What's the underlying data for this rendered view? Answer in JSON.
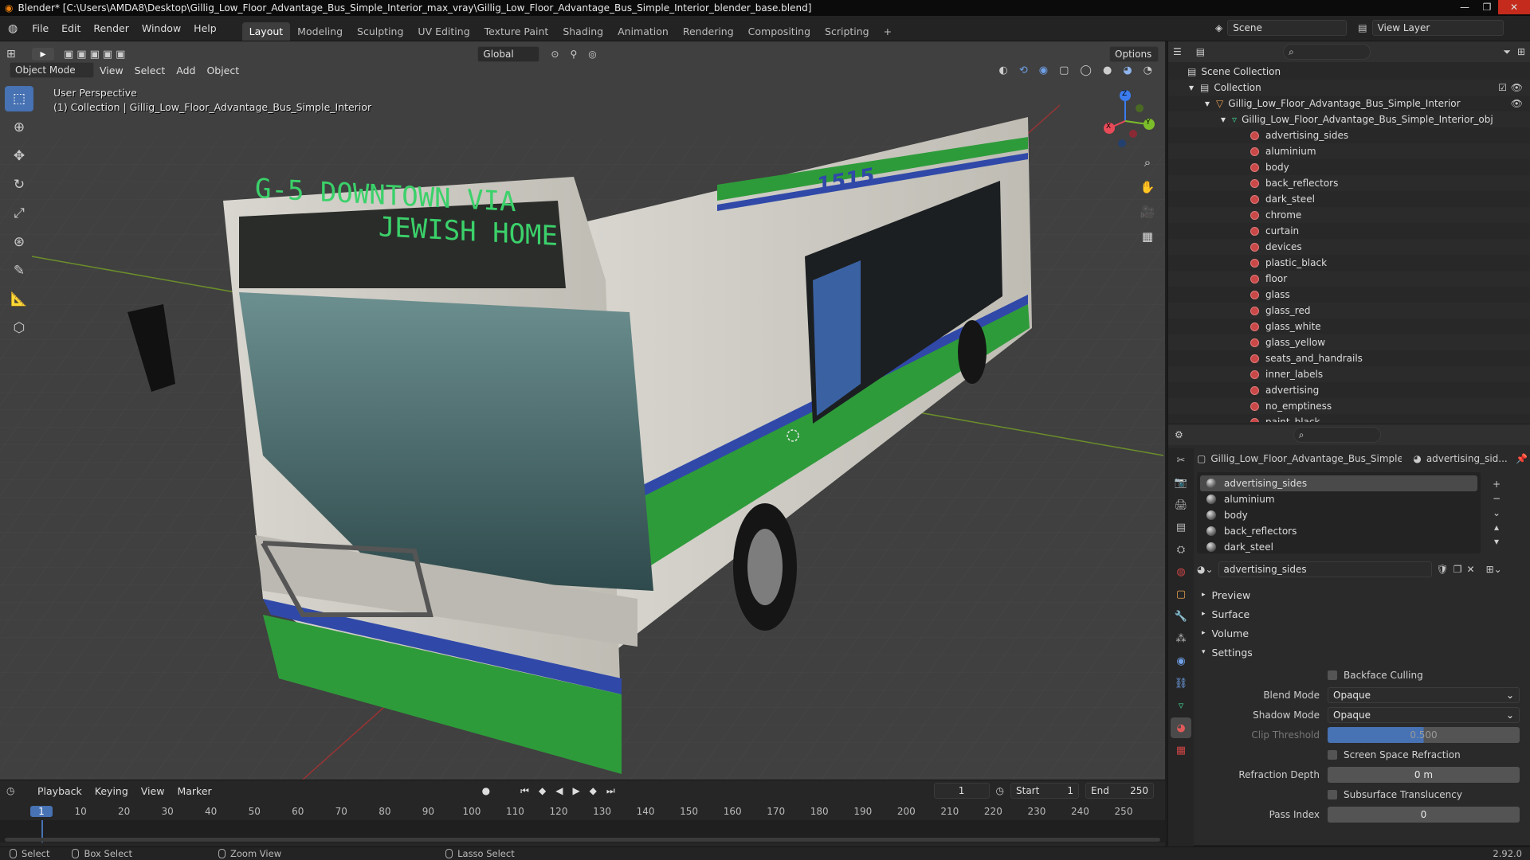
{
  "window": {
    "title": "Blender* [C:\\Users\\AMDA8\\Desktop\\Gillig_Low_Floor_Advantage_Bus_Simple_Interior_max_vray\\Gillig_Low_Floor_Advantage_Bus_Simple_Interior_blender_base.blend]"
  },
  "menu": {
    "items": [
      "File",
      "Edit",
      "Render",
      "Window",
      "Help"
    ],
    "workspaces": [
      "Layout",
      "Modeling",
      "Sculpting",
      "UV Editing",
      "Texture Paint",
      "Shading",
      "Animation",
      "Rendering",
      "Compositing",
      "Scripting"
    ],
    "active_workspace": "Layout",
    "scene_label": "Scene",
    "view_layer_label": "View Layer"
  },
  "viewport": {
    "mode": "Object Mode",
    "menus": [
      "View",
      "Select",
      "Add",
      "Object"
    ],
    "transform_orientation": "Global",
    "options_label": "Options",
    "info_line1": "User Perspective",
    "info_line2": "(1) Collection | Gillig_Low_Floor_Advantage_Bus_Simple_Interior",
    "destination_sign_line1": "G-5  DOWNTOWN VIA",
    "destination_sign_line2": "JEWISH HOME",
    "bus_number": "1515",
    "gizmo": {
      "x": "X",
      "y": "Y",
      "z": "Z"
    }
  },
  "outliner": {
    "scene_collection": "Scene Collection",
    "collection": "Collection",
    "object": "Gillig_Low_Floor_Advantage_Bus_Simple_Interior",
    "mesh": "Gillig_Low_Floor_Advantage_Bus_Simple_Interior_obj",
    "materials": [
      "advertising_sides",
      "aluminium",
      "body",
      "back_reflectors",
      "dark_steel",
      "chrome",
      "curtain",
      "devices",
      "plastic_black",
      "floor",
      "glass",
      "glass_red",
      "glass_white",
      "glass_yellow",
      "seats_and_handrails",
      "inner_labels",
      "advertising",
      "no_emptiness",
      "paint_black"
    ]
  },
  "properties": {
    "object_name": "Gillig_Low_Floor_Advantage_Bus_Simple_In...",
    "material_name_short": "advertising_sid...",
    "slots": [
      "advertising_sides",
      "aluminium",
      "body",
      "back_reflectors",
      "dark_steel"
    ],
    "selected_slot": "advertising_sides",
    "material_field": "advertising_sides",
    "panels": [
      "Preview",
      "Surface",
      "Volume",
      "Settings"
    ],
    "settings": {
      "backface_culling": "Backface Culling",
      "blend_mode_label": "Blend Mode",
      "blend_mode": "Opaque",
      "shadow_mode_label": "Shadow Mode",
      "shadow_mode": "Opaque",
      "clip_threshold_label": "Clip Threshold",
      "clip_threshold": "0.500",
      "screen_space_refraction": "Screen Space Refraction",
      "refraction_depth_label": "Refraction Depth",
      "refraction_depth": "0 m",
      "subsurface_translucency": "Subsurface Translucency",
      "pass_index_label": "Pass Index",
      "pass_index": "0"
    }
  },
  "timeline": {
    "menus": [
      "Playback",
      "Keying",
      "View",
      "Marker"
    ],
    "current_frame": "1",
    "start_label": "Start",
    "start": "1",
    "end_label": "End",
    "end": "250",
    "ticks": [
      "1",
      "10",
      "20",
      "30",
      "40",
      "50",
      "60",
      "70",
      "80",
      "90",
      "100",
      "110",
      "120",
      "130",
      "140",
      "150",
      "160",
      "170",
      "180",
      "190",
      "200",
      "210",
      "220",
      "230",
      "240",
      "250"
    ]
  },
  "statusbar": {
    "select": "Select",
    "box_select": "Box Select",
    "zoom_view": "Zoom View",
    "lasso_select": "Lasso Select",
    "version": "2.92.0"
  }
}
